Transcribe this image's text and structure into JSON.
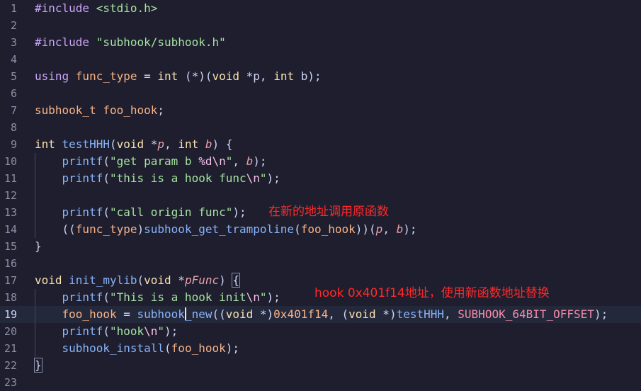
{
  "colors": {
    "background": "#1e1e2e",
    "current_line": "#24283b",
    "line_numbers": "#8b8fa6",
    "annotation": "#ff2a2a"
  },
  "editor": {
    "current_line_number": 19,
    "lines": [
      {
        "n": "1",
        "tokens": [
          [
            "pre",
            "#include "
          ],
          [
            "str",
            "<stdio.h>"
          ]
        ]
      },
      {
        "n": "2",
        "tokens": []
      },
      {
        "n": "3",
        "tokens": [
          [
            "pre",
            "#include "
          ],
          [
            "str",
            "\"subhook/subhook.h\""
          ]
        ]
      },
      {
        "n": "4",
        "tokens": []
      },
      {
        "n": "5",
        "tokens": [
          [
            "kw",
            "using "
          ],
          [
            "ct",
            "func_type"
          ],
          [
            "pl",
            " = "
          ],
          [
            "ty",
            "int"
          ],
          [
            "pl",
            " (*)("
          ],
          [
            "ty",
            "void"
          ],
          [
            "pl",
            " *p, "
          ],
          [
            "ty",
            "int"
          ],
          [
            "pl",
            " b);"
          ]
        ]
      },
      {
        "n": "6",
        "tokens": []
      },
      {
        "n": "7",
        "tokens": [
          [
            "ct",
            "subhook_t"
          ],
          [
            "pl",
            " "
          ],
          [
            "ct",
            "foo_hook"
          ],
          [
            "pl",
            ";"
          ]
        ]
      },
      {
        "n": "8",
        "tokens": []
      },
      {
        "n": "9",
        "tokens": [
          [
            "ty",
            "int"
          ],
          [
            "pl",
            " "
          ],
          [
            "fn",
            "testHHH"
          ],
          [
            "pl",
            "("
          ],
          [
            "ty",
            "void"
          ],
          [
            "pl",
            " *"
          ],
          [
            "par",
            "p"
          ],
          [
            "pl",
            ", "
          ],
          [
            "ty",
            "int"
          ],
          [
            "pl",
            " "
          ],
          [
            "par",
            "b"
          ],
          [
            "pl",
            ") {"
          ]
        ]
      },
      {
        "n": "10",
        "tokens": [
          [
            "pl",
            "    "
          ],
          [
            "fn",
            "printf"
          ],
          [
            "pl",
            "("
          ],
          [
            "str",
            "\"get param b "
          ],
          [
            "esc",
            "%d\\n"
          ],
          [
            "str",
            "\""
          ],
          [
            "pl",
            ", "
          ],
          [
            "par",
            "b"
          ],
          [
            "pl",
            ");"
          ]
        ]
      },
      {
        "n": "11",
        "tokens": [
          [
            "pl",
            "    "
          ],
          [
            "fn",
            "printf"
          ],
          [
            "pl",
            "("
          ],
          [
            "str",
            "\"this is a hook func"
          ],
          [
            "esc",
            "\\n"
          ],
          [
            "str",
            "\""
          ],
          [
            "pl",
            ");"
          ]
        ]
      },
      {
        "n": "12",
        "tokens": []
      },
      {
        "n": "13",
        "tokens": [
          [
            "pl",
            "    "
          ],
          [
            "fn",
            "printf"
          ],
          [
            "pl",
            "("
          ],
          [
            "str",
            "\"call origin func\""
          ],
          [
            "pl",
            ");"
          ]
        ]
      },
      {
        "n": "14",
        "tokens": [
          [
            "pl",
            "    (("
          ],
          [
            "ct",
            "func_type"
          ],
          [
            "pl",
            ")"
          ],
          [
            "fn",
            "subhook_get_trampoline"
          ],
          [
            "pl",
            "("
          ],
          [
            "ct",
            "foo_hook"
          ],
          [
            "pl",
            "))("
          ],
          [
            "par",
            "p"
          ],
          [
            "pl",
            ", "
          ],
          [
            "par",
            "b"
          ],
          [
            "pl",
            ");"
          ]
        ]
      },
      {
        "n": "15",
        "tokens": [
          [
            "pl",
            "}"
          ]
        ]
      },
      {
        "n": "16",
        "tokens": []
      },
      {
        "n": "17",
        "tokens": [
          [
            "ty",
            "void"
          ],
          [
            "pl",
            " "
          ],
          [
            "fn",
            "init_mylib"
          ],
          [
            "pl",
            "("
          ],
          [
            "ty",
            "void"
          ],
          [
            "pl",
            " *"
          ],
          [
            "par",
            "pFunc"
          ],
          [
            "pl",
            ") "
          ],
          [
            "bm",
            "{"
          ]
        ]
      },
      {
        "n": "18",
        "tokens": [
          [
            "pl",
            "    "
          ],
          [
            "fn",
            "printf"
          ],
          [
            "pl",
            "("
          ],
          [
            "str",
            "\"This is a hook init"
          ],
          [
            "esc",
            "\\n"
          ],
          [
            "str",
            "\""
          ],
          [
            "pl",
            ");"
          ]
        ]
      },
      {
        "n": "19",
        "tokens": [
          [
            "pl",
            "    "
          ],
          [
            "ct",
            "foo_hook"
          ],
          [
            "pl",
            " = "
          ],
          [
            "fn",
            "subhook"
          ],
          [
            "caret",
            ""
          ],
          [
            "fn",
            "_new"
          ],
          [
            "pl",
            "(("
          ],
          [
            "ty",
            "void"
          ],
          [
            "pl",
            " *)"
          ],
          [
            "num",
            "0x401f14"
          ],
          [
            "pl",
            ", ("
          ],
          [
            "ty",
            "void"
          ],
          [
            "pl",
            " *)"
          ],
          [
            "fn",
            "testHHH"
          ],
          [
            "pl",
            ", "
          ],
          [
            "mac",
            "SUBHOOK_64BIT_OFFSET"
          ],
          [
            "pl",
            ");"
          ]
        ]
      },
      {
        "n": "20",
        "tokens": [
          [
            "pl",
            "    "
          ],
          [
            "fn",
            "printf"
          ],
          [
            "pl",
            "("
          ],
          [
            "str",
            "\"hook"
          ],
          [
            "esc",
            "\\n"
          ],
          [
            "str",
            "\""
          ],
          [
            "pl",
            ");"
          ]
        ]
      },
      {
        "n": "21",
        "tokens": [
          [
            "pl",
            "    "
          ],
          [
            "fn",
            "subhook_install"
          ],
          [
            "pl",
            "("
          ],
          [
            "ct",
            "foo_hook"
          ],
          [
            "pl",
            ");"
          ]
        ]
      },
      {
        "n": "22",
        "tokens": [
          [
            "bm",
            "}"
          ]
        ]
      },
      {
        "n": "23",
        "tokens": []
      }
    ]
  },
  "annotations": {
    "note_1": "在新的地址调用原函数",
    "note_2": "hook 0x401f14地址，使用新函数地址替换"
  }
}
